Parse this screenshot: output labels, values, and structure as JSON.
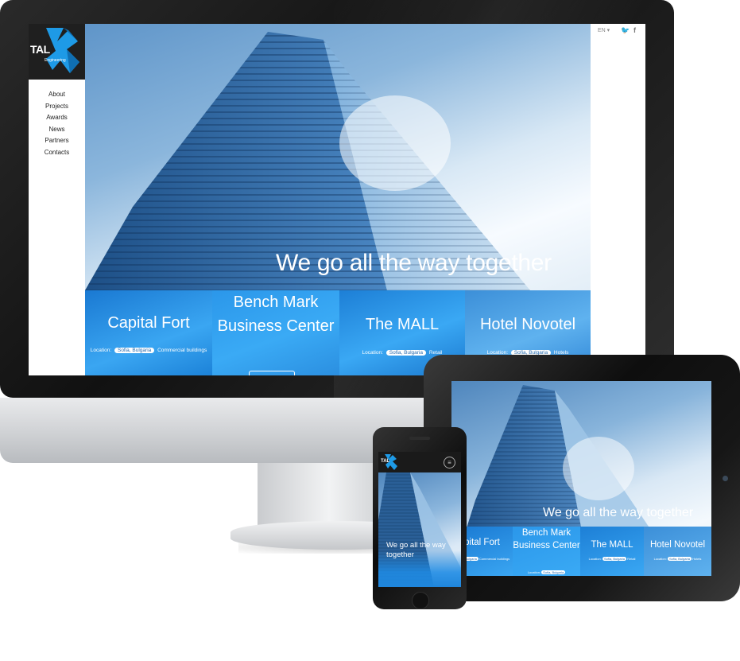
{
  "desktop": {
    "logo": {
      "text": "TAL",
      "tagline": "Engineering"
    },
    "nav": [
      "About",
      "Projects",
      "Awards",
      "News",
      "Partners",
      "Contacts"
    ],
    "language": "EN ▾",
    "social": {
      "twitter": "twitter-icon",
      "facebook": "f"
    },
    "hero_title": "We go all the way together",
    "tiles": [
      {
        "title": "Capital Fort",
        "location_label": "Location:",
        "location": "Sofia, Bulgaria",
        "category": "Commercial buildings"
      },
      {
        "title": "Bench Mark Business Center",
        "location_label": "",
        "location": "",
        "category": ""
      },
      {
        "title": "The MALL",
        "location_label": "Location:",
        "location": "Sofia, Bulgaria",
        "category": "Retail"
      },
      {
        "title": "Hotel Novotel",
        "location_label": "Location:",
        "location": "Sofia, Bulgaria",
        "category": "Hotels"
      }
    ]
  },
  "tablet": {
    "hero_title": "We go all the way together",
    "tiles": [
      {
        "title": "pital Fort",
        "location_label": "",
        "location": "Sofia, Bulgaria",
        "category": "Commercial buildings"
      },
      {
        "title": "Bench Mark Business Center",
        "location_label": "Location:",
        "location": "Sofia, Bulgaria",
        "category": ""
      },
      {
        "title": "The MALL",
        "location_label": "Location:",
        "location": "Sofia, Bulgaria",
        "category": "Retail"
      },
      {
        "title": "Hotel Novotel",
        "location_label": "Location:",
        "location": "Sofia, Bulgaria",
        "category": "Hotels"
      }
    ]
  },
  "phone": {
    "logo": {
      "text": "TAL"
    },
    "menu_icon": "≡",
    "hero_title": "We go all the way together"
  },
  "colors": {
    "accent": "#1e8fe8",
    "tile_blue": "#2b8fe0",
    "dark": "#1f1f1f"
  }
}
